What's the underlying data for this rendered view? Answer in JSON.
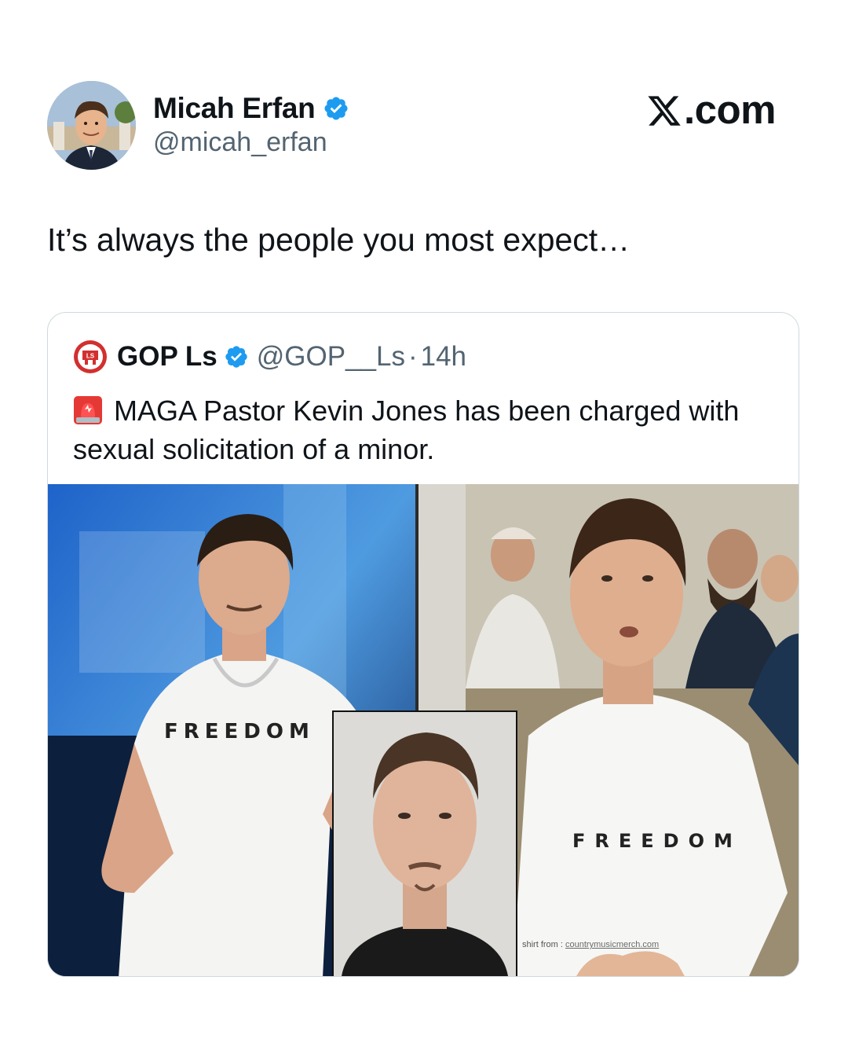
{
  "author": {
    "name": "Micah Erfan",
    "handle": "@micah_erfan",
    "verified": true
  },
  "brand": {
    "label": ".com",
    "icon": "x-logo-icon"
  },
  "tweet": {
    "text": "It’s always the people you most expect…"
  },
  "quoted_tweet": {
    "name": "GOP Ls",
    "handle": "@GOP__Ls",
    "separator": "·",
    "time": "14h",
    "verified": true,
    "logo_text": "LS",
    "text": "MAGA Pastor Kevin Jones has been charged with sexual solicitation of a minor.",
    "emoji": "siren-emoji-icon"
  },
  "media": {
    "left_shirt_text": "FREEDOM",
    "right_shirt_text": "FREEDOM",
    "credit_prefix": "shirt from : ",
    "credit_link": "countrymusicmerch.com"
  },
  "colors": {
    "verified_blue": "#1d9bf0",
    "text_primary": "#0f1419",
    "text_secondary": "#536471",
    "border": "#cfd9de",
    "logo_red": "#d32f2f"
  }
}
